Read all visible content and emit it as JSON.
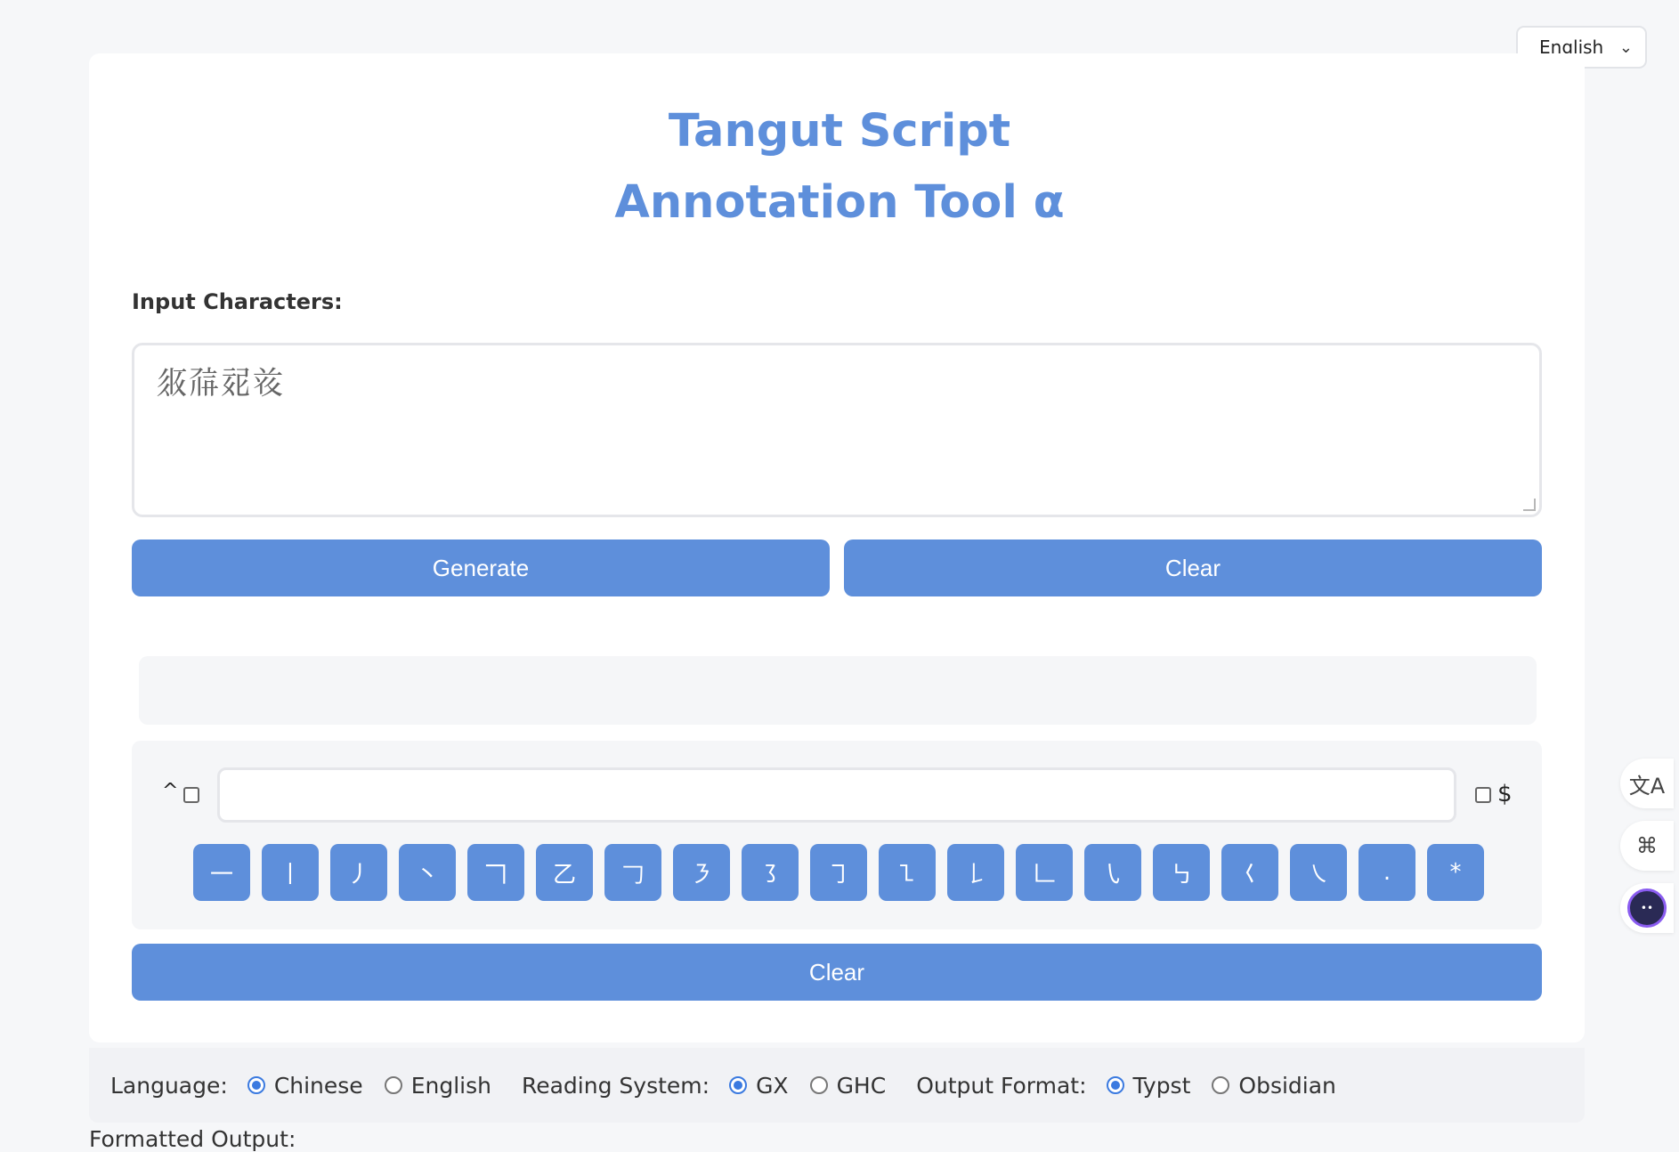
{
  "language_selector": {
    "value": "English"
  },
  "header": {
    "title_line1": "Tangut Script",
    "title_line2": "Annotation Tool α"
  },
  "input": {
    "label": "Input Characters:",
    "value": "𗼇𗗚𗵿𘝞"
  },
  "buttons": {
    "generate": "Generate",
    "clear": "Clear",
    "clear_bottom": "Clear"
  },
  "stroke_search": {
    "start_anchor": "^",
    "end_anchor": "$",
    "pattern_value": "",
    "strokes": [
      "一",
      "丨",
      "丿",
      "丶",
      "𠃍",
      "乙",
      "𠃌",
      "㇋",
      "㇌",
      "㇆",
      "㇅",
      "𠄌",
      "𠃊",
      "㇂",
      "㇉",
      "𡿨",
      "㇏",
      ".",
      "*"
    ]
  },
  "options": {
    "language": {
      "label": "Language:",
      "choices": [
        "Chinese",
        "English"
      ],
      "selected": "Chinese"
    },
    "reading_system": {
      "label": "Reading System:",
      "choices": [
        "GX",
        "GHC"
      ],
      "selected": "GX"
    },
    "output_format": {
      "label": "Output Format:",
      "choices": [
        "Typst",
        "Obsidian"
      ],
      "selected": "Typst"
    }
  },
  "formatted_output": {
    "label": "Formatted Output:"
  },
  "side_tools": {
    "icons": [
      "translate-icon",
      "command-icon",
      "assistant-face-icon"
    ]
  },
  "colors": {
    "accent": "#5e8fdb",
    "radio": "#3b7ae0",
    "background": "#f6f7f9"
  }
}
